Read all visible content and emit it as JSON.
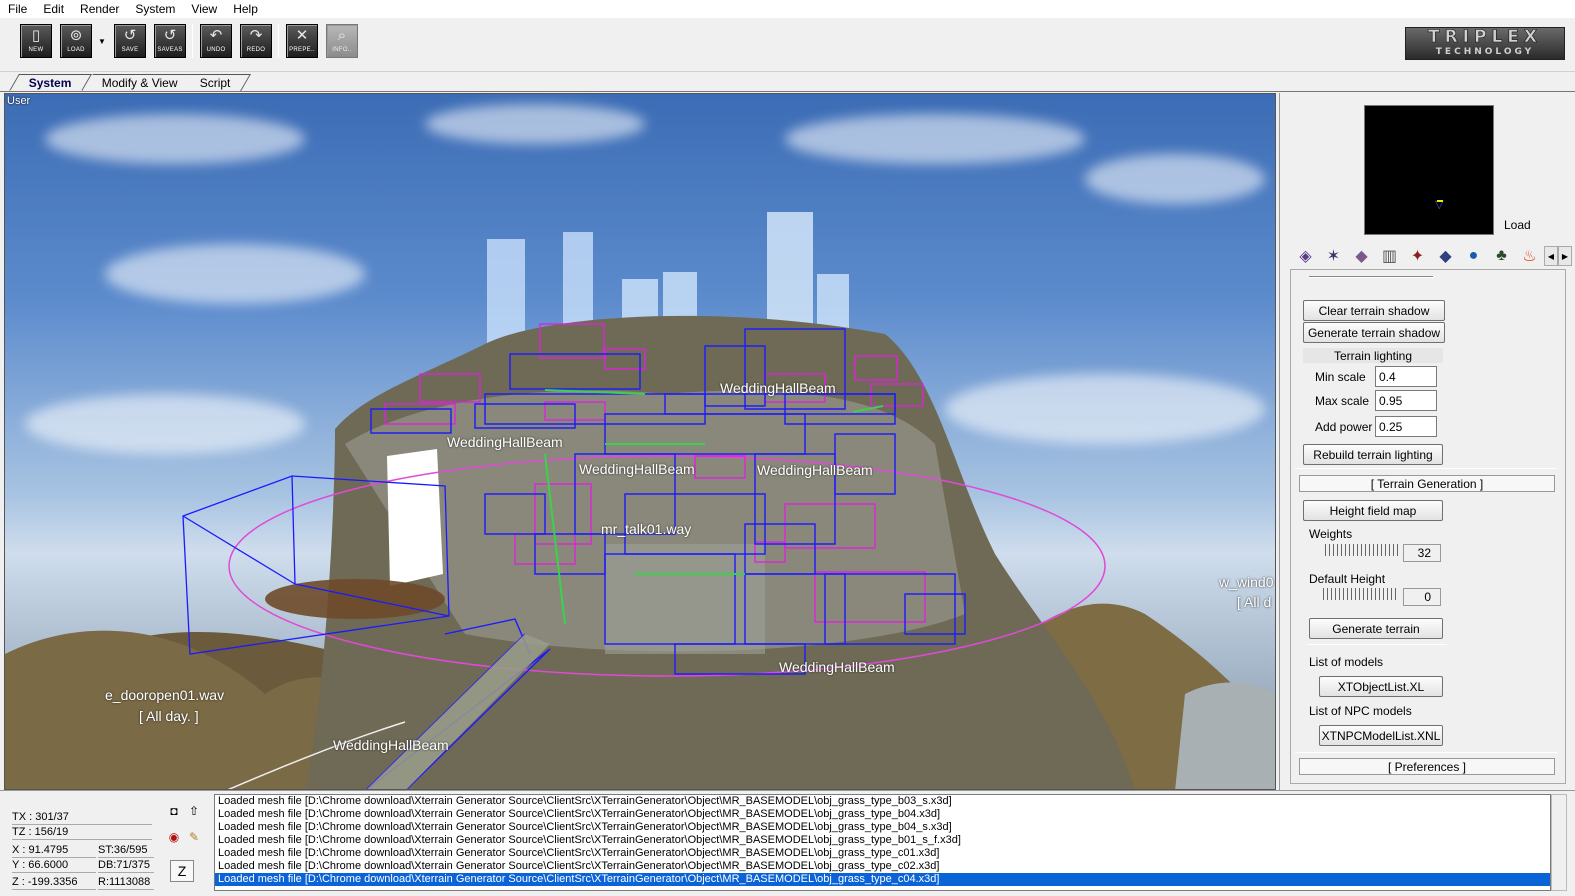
{
  "menu": [
    "File",
    "Edit",
    "Render",
    "System",
    "View",
    "Help"
  ],
  "toolbar": {
    "buttons": [
      {
        "label": "NEW",
        "icon": "new-file-icon",
        "glyph": "▯"
      },
      {
        "label": "LOAD",
        "icon": "load-icon",
        "glyph": "⊚"
      },
      {
        "label": "SAVE",
        "icon": "save-icon",
        "glyph": "↺"
      },
      {
        "label": "SAVEAS",
        "icon": "save-as-icon",
        "glyph": "↺"
      },
      {
        "label": "UNDO",
        "icon": "undo-icon",
        "glyph": "↶"
      },
      {
        "label": "REDO",
        "icon": "redo-icon",
        "glyph": "↷"
      },
      {
        "label": "PREPE..",
        "icon": "tools-icon",
        "glyph": "✕"
      },
      {
        "label": "INFO..",
        "icon": "info-icon",
        "glyph": "⌕"
      }
    ],
    "logo_line1": "TRIPLEX",
    "logo_line2": "TECHNOLOGY"
  },
  "tabs": [
    "System",
    "Modify & View",
    "Script"
  ],
  "viewport": {
    "label": "User",
    "overlay_texts": [
      "WeddingHallBeam",
      "WeddingHallBeam",
      "WeddingHallBeam",
      "WeddingHallBeam",
      "WeddingHallBeam",
      "mr_talk01.way",
      "e_dooropen01.wav",
      "[ All day. ]",
      "w_wind0",
      "[ All d"
    ]
  },
  "panel": {
    "minimap_load": "Load",
    "strip_icons": [
      "cube-icon",
      "star-icon",
      "grid-icon",
      "building-icon",
      "compass-icon",
      "plane-icon",
      "globe-icon",
      "tree-icon",
      "fire-icon"
    ],
    "clear_shadow": "Clear terrain shadow",
    "generate_shadow": "Generate terrain shadow",
    "terrain_lighting": "Terrain lighting",
    "min_scale_label": "Min scale",
    "min_scale_value": "0.4",
    "max_scale_label": "Max scale",
    "max_scale_value": "0.95",
    "add_power_label": "Add power",
    "add_power_value": "0.25",
    "rebuild_lighting": "Rebuild terrain lighting",
    "terrain_generation": "[ Terrain Generation ]",
    "height_field_map": "Height field map",
    "weights_label": "Weights",
    "weights_value": "32",
    "default_height_label": "Default Height",
    "default_height_value": "0",
    "generate_terrain": "Generate terrain",
    "list_of_models_label": "List of models",
    "list_of_models_value": "XTObjectList.XL",
    "list_of_npc_label": "List of NPC models",
    "list_of_npc_value": "XTNPCModelList.XNL",
    "preferences": "[ Preferences ]"
  },
  "status": {
    "tx": "TX : 301/37",
    "tz": "TZ : 156/19",
    "x": "X : 91.4795",
    "y": "Y : 66.6000",
    "z": "Z : -199.3356",
    "st": "ST:36/595",
    "db": "DB:71/375",
    "r": "R:1113088",
    "z_button": "Z"
  },
  "log": [
    "Loaded mesh file [D:\\Chrome download\\Xterrain Generator Source\\ClientSrc\\XTerrainGenerator\\Object\\MR_BASEMODEL\\obj_grass_type_b03_s.x3d]",
    "Loaded mesh file [D:\\Chrome download\\Xterrain Generator Source\\ClientSrc\\XTerrainGenerator\\Object\\MR_BASEMODEL\\obj_grass_type_b04.x3d]",
    "Loaded mesh file [D:\\Chrome download\\Xterrain Generator Source\\ClientSrc\\XTerrainGenerator\\Object\\MR_BASEMODEL\\obj_grass_type_b04_s.x3d]",
    "Loaded mesh file [D:\\Chrome download\\Xterrain Generator Source\\ClientSrc\\XTerrainGenerator\\Object\\MR_BASEMODEL\\obj_grass_type_b01_s_f.x3d]",
    "Loaded mesh file [D:\\Chrome download\\Xterrain Generator Source\\ClientSrc\\XTerrainGenerator\\Object\\MR_BASEMODEL\\obj_grass_type_c01.x3d]",
    "Loaded mesh file [D:\\Chrome download\\Xterrain Generator Source\\ClientSrc\\XTerrainGenerator\\Object\\MR_BASEMODEL\\obj_grass_type_c02.x3d]",
    "Loaded mesh file [D:\\Chrome download\\Xterrain Generator Source\\ClientSrc\\XTerrainGenerator\\Object\\MR_BASEMODEL\\obj_grass_type_c04.x3d]"
  ]
}
